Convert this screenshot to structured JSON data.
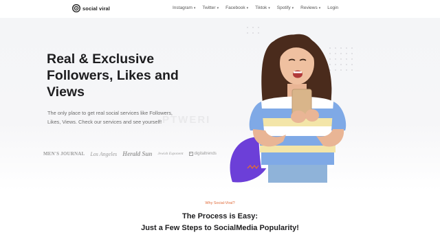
{
  "nav": {
    "logo_text": "social viral",
    "menu": [
      {
        "label": "Instagram",
        "caret": true
      },
      {
        "label": "Twitter",
        "caret": true
      },
      {
        "label": "Facebook",
        "caret": true
      },
      {
        "label": "Tiktok",
        "caret": true
      },
      {
        "label": "Spotify",
        "caret": true
      },
      {
        "label": "Reviews",
        "caret": true
      },
      {
        "label": "Login",
        "caret": false
      }
    ]
  },
  "hero": {
    "headline_line1": "Real & Exclusive",
    "headline_line2": "Followers, Likes and",
    "headline_line3": "Views",
    "subtext": "The only place to get real social services like Followers, Likes, Views. Check our services and see yourself!",
    "watermark": "PTWERI",
    "brands": [
      "MEN'S JOURNAL",
      "Los Angeles",
      "Herald Sun",
      "Jewish Exponent",
      "digitaltrends"
    ]
  },
  "section": {
    "eyebrow": "Why Social-Viral?",
    "title_line1": "The Process is Easy:",
    "title_line2": "Just a Few Steps to SocialMedia Popularity!"
  },
  "colors": {
    "accent": "#e06a38",
    "purple": "#6c3fd8",
    "stripe_blue": "#7fa9e6",
    "stripe_yellow": "#f3e5a8"
  }
}
